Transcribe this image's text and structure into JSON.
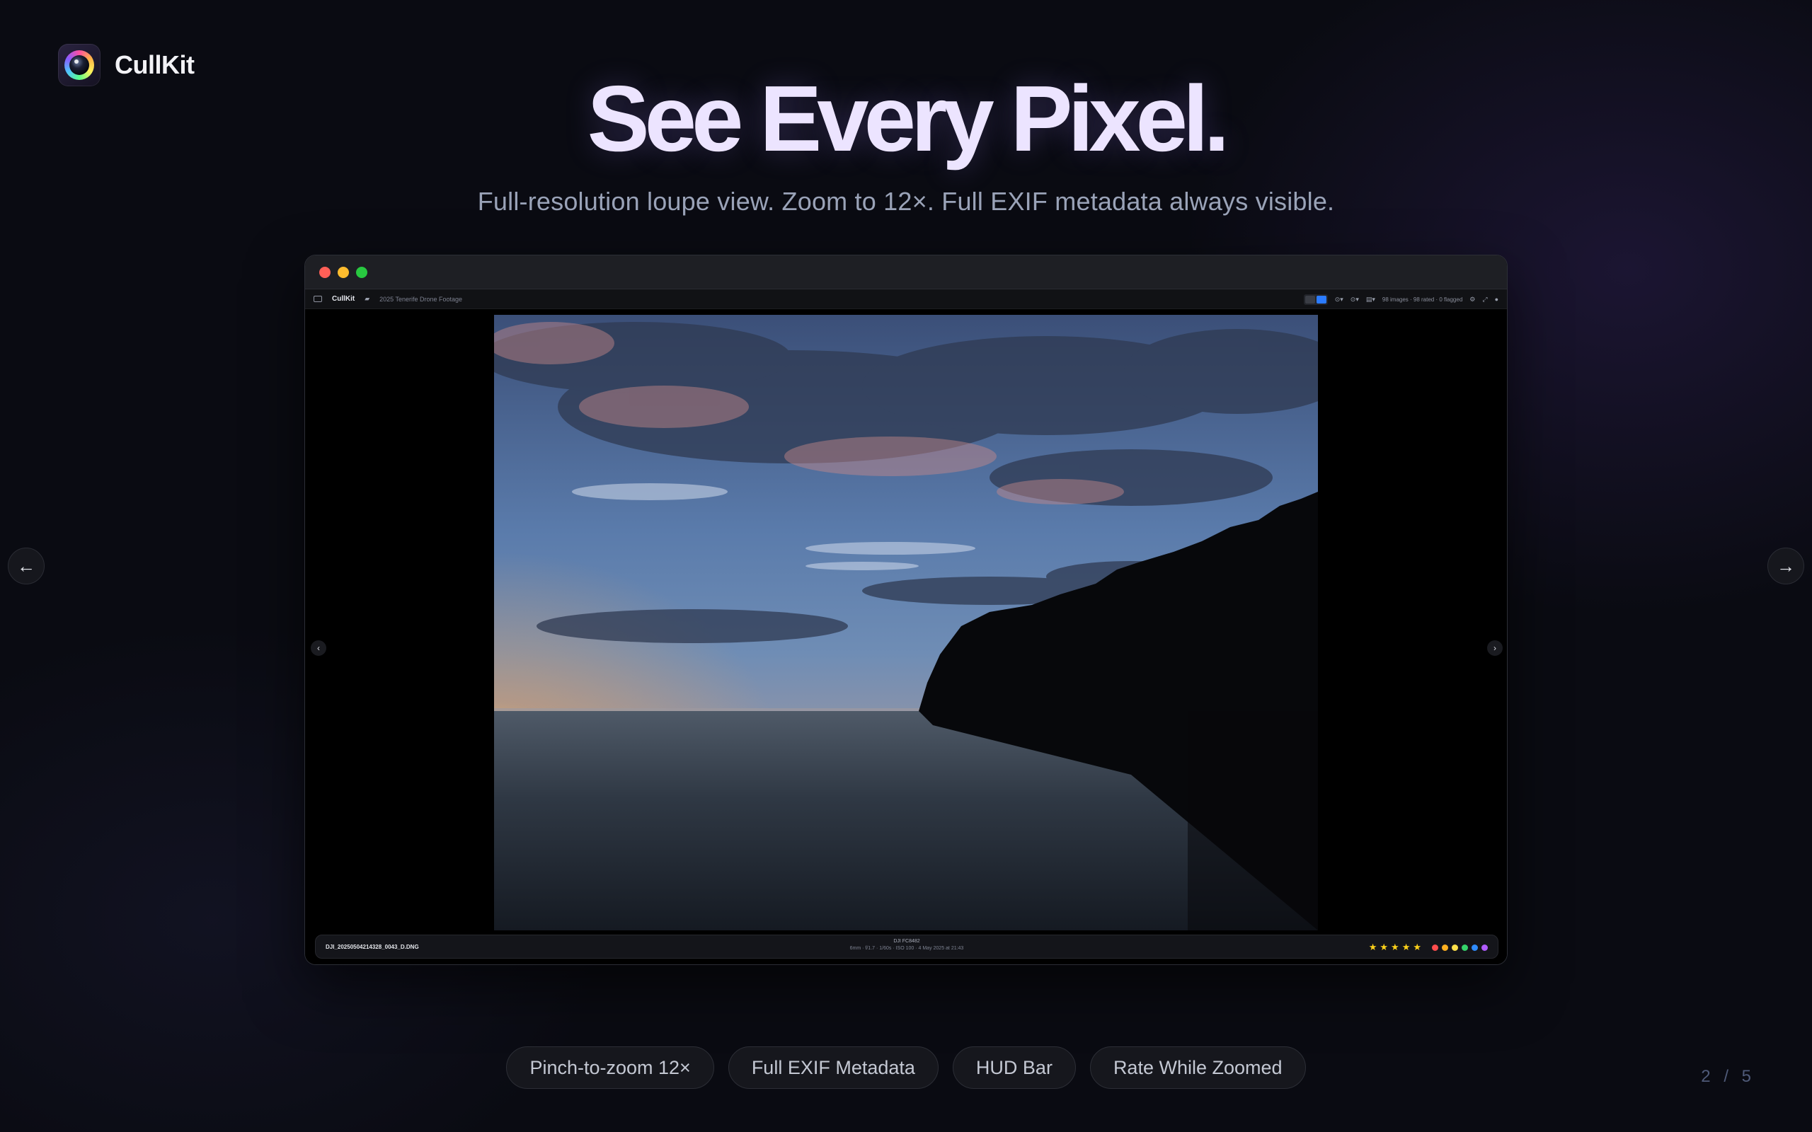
{
  "brand": {
    "name": "CullKit"
  },
  "hero": {
    "title": "See Every Pixel.",
    "subtitle": "Full-resolution loupe view. Zoom to 12×. Full EXIF metadata always visible."
  },
  "app": {
    "name": "CullKit",
    "folder": "2025 Tenerife Drone Footage",
    "status": "98 images · 98 rated · 0 flagged",
    "hud": {
      "filename": "DJI_20250504214328_0043_D.DNG",
      "camera": "DJI FC8482",
      "exif": "6mm · f/1.7 · 1/60s · ISO 100 · 4 May 2025 at 21:43",
      "stars": [
        "★",
        "★",
        "★",
        "★",
        "★"
      ],
      "color_labels": [
        "#ff4d4d",
        "#ffb020",
        "#ffe04a",
        "#35d46a",
        "#2f8cff",
        "#b05cff"
      ]
    }
  },
  "nav": {
    "prev": "←",
    "next": "→",
    "photo_prev": "‹",
    "photo_next": "›"
  },
  "features": [
    "Pinch-to-zoom 12×",
    "Full EXIF Metadata",
    "HUD Bar",
    "Rate While Zoomed"
  ],
  "pager": {
    "text": "2 / 5"
  }
}
